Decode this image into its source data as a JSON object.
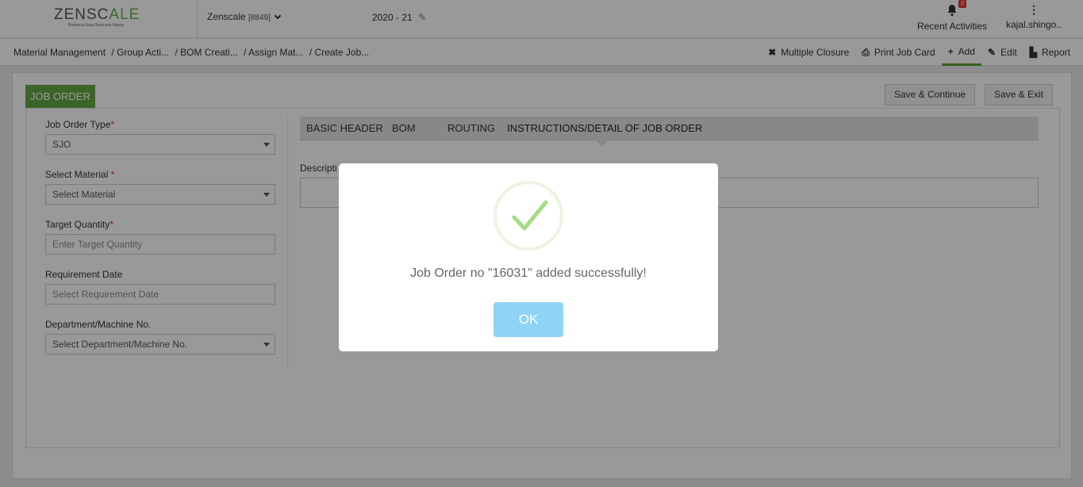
{
  "header": {
    "logo_text_left": "ZENSC",
    "logo_text_accent": "A",
    "logo_text_right": "LE",
    "logo_tagline": "Business Easy Business Happy",
    "company_name": "Zenscale",
    "company_code": "[8849]",
    "fiscal_year": "2020 - 21",
    "notifications_count": "0",
    "recent_activities_label": "Recent Activities",
    "user_name": "kajal.shingo.."
  },
  "breadcrumb": {
    "items": [
      "Material Management",
      "/ Group Acti...",
      "/ BOM Creati...",
      "/ Assign Mat...",
      "/ Create Job..."
    ]
  },
  "toolbar": {
    "multiple_closure": "Multiple Closure",
    "print_job_card": "Print Job Card",
    "add": "Add",
    "edit": "Edit",
    "report": "Report"
  },
  "form": {
    "tab_title": "JOB ORDER",
    "save_continue": "Save & Continue",
    "save_exit": "Save & Exit",
    "job_order_type_label": "Job Order Type",
    "job_order_type_value": "SJO",
    "select_material_label": "Select Material",
    "select_material_value": "Select Material",
    "target_quantity_label": "Target Quantity",
    "target_quantity_placeholder": "Enter Target Quantity",
    "requirement_date_label": "Requirement Date",
    "requirement_date_placeholder": "Select Requirement Date",
    "department_label": "Department/Machine No.",
    "department_value": "Select Department/Machine No.",
    "required_mark": "*"
  },
  "tabs": [
    "BASIC HEADER",
    "BOM",
    "ROUTING",
    "INSTRUCTIONS/DETAIL OF JOB ORDER"
  ],
  "description_label": "Descripti",
  "modal": {
    "message": "Job Order no \"16031\" added successfully!",
    "ok_label": "OK"
  },
  "colors": {
    "accent_green": "#63a844",
    "badge_red": "#d9342b",
    "ok_button": "#8fd3f5"
  }
}
